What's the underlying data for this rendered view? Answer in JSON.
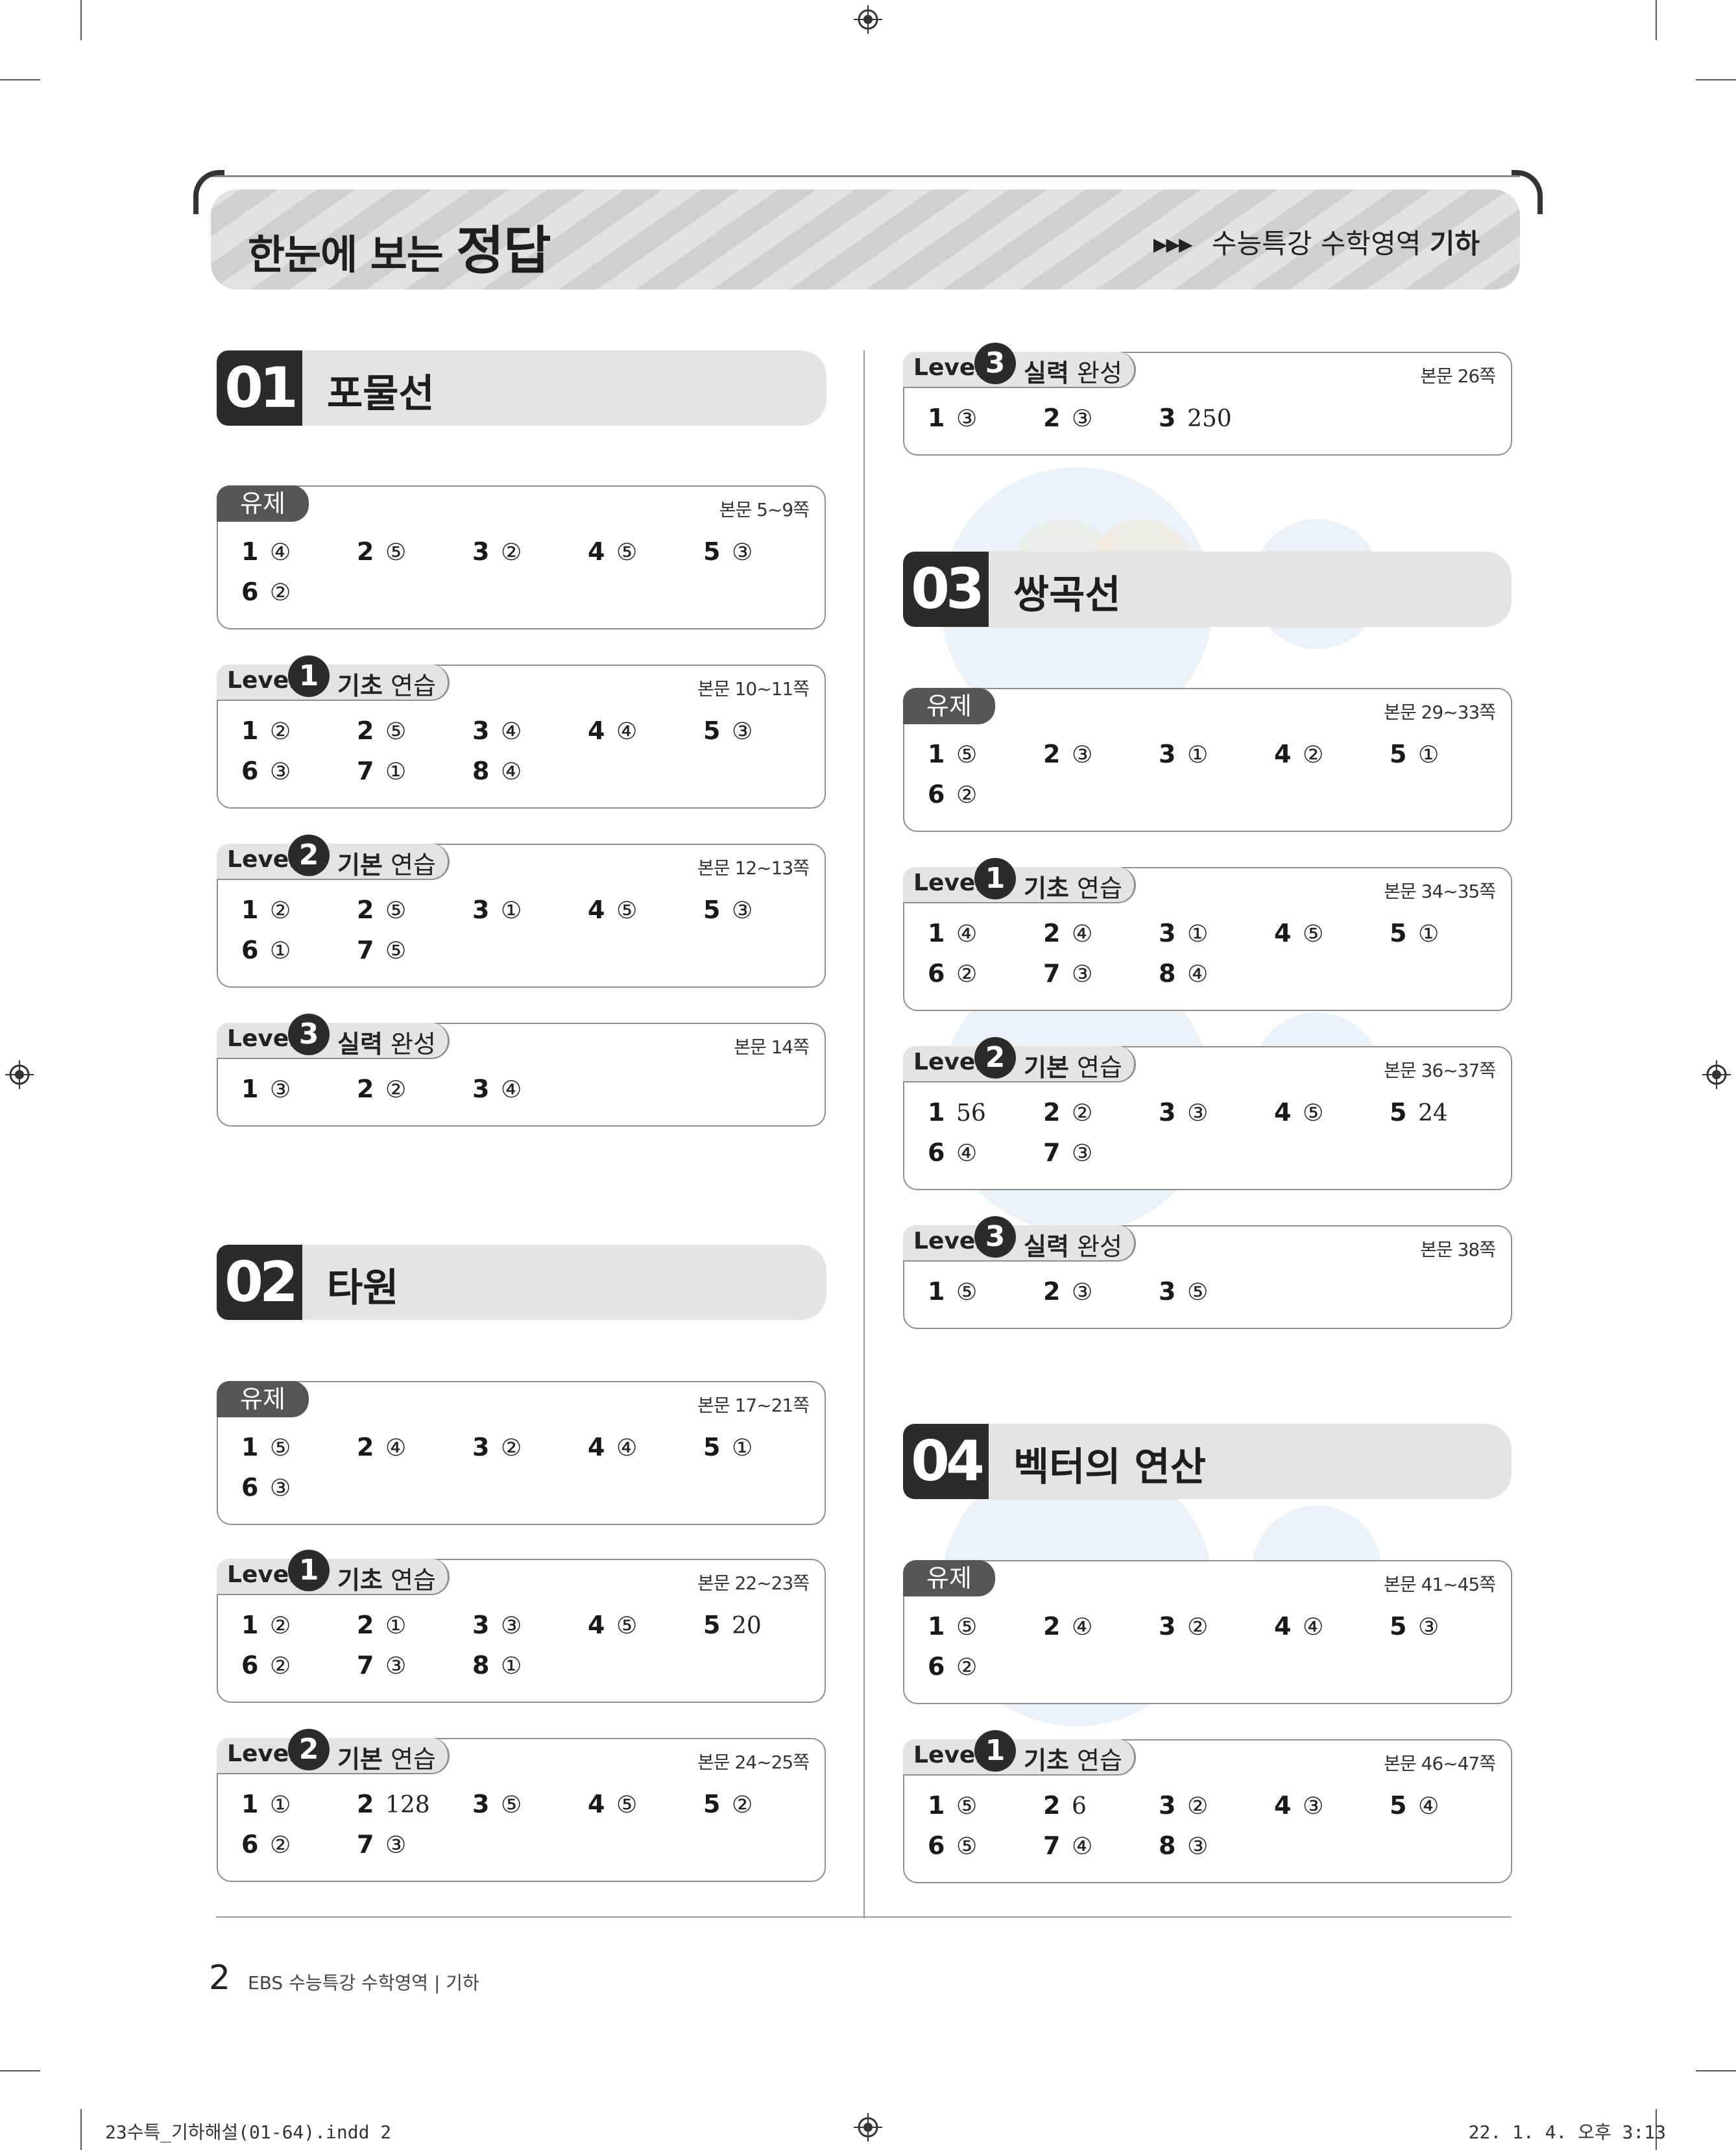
{
  "header": {
    "title_prefix": "한눈에 보는",
    "title_main": "정답",
    "book_prefix": "수능특강 수학영역",
    "book_subject": "기하"
  },
  "chapters": [
    {
      "num": "01",
      "title": "포물선"
    },
    {
      "num": "02",
      "title": "타원"
    },
    {
      "num": "03",
      "title": "쌍곡선"
    },
    {
      "num": "04",
      "title": "벡터의 연산"
    }
  ],
  "boxes": [
    {
      "type": "유제",
      "pages": "본문 5~9쪽",
      "answers": [
        [
          "1",
          "④"
        ],
        [
          "2",
          "⑤"
        ],
        [
          "3",
          "②"
        ],
        [
          "4",
          "⑤"
        ],
        [
          "5",
          "③"
        ],
        [
          "6",
          "②"
        ]
      ]
    },
    {
      "type": "level",
      "level": "1",
      "kind_bold": "기초",
      "kind_rest": "연습",
      "pages": "본문 10~11쪽",
      "answers": [
        [
          "1",
          "②"
        ],
        [
          "2",
          "⑤"
        ],
        [
          "3",
          "④"
        ],
        [
          "4",
          "④"
        ],
        [
          "5",
          "③"
        ],
        [
          "6",
          "③"
        ],
        [
          "7",
          "①"
        ],
        [
          "8",
          "④"
        ]
      ]
    },
    {
      "type": "level",
      "level": "2",
      "kind_bold": "기본",
      "kind_rest": "연습",
      "pages": "본문 12~13쪽",
      "answers": [
        [
          "1",
          "②"
        ],
        [
          "2",
          "⑤"
        ],
        [
          "3",
          "①"
        ],
        [
          "4",
          "⑤"
        ],
        [
          "5",
          "③"
        ],
        [
          "6",
          "①"
        ],
        [
          "7",
          "⑤"
        ]
      ]
    },
    {
      "type": "level",
      "level": "3",
      "kind_bold": "실력",
      "kind_rest": "완성",
      "pages": "본문 14쪽",
      "answers": [
        [
          "1",
          "③"
        ],
        [
          "2",
          "②"
        ],
        [
          "3",
          "④"
        ]
      ]
    },
    {
      "type": "유제",
      "pages": "본문 17~21쪽",
      "answers": [
        [
          "1",
          "⑤"
        ],
        [
          "2",
          "④"
        ],
        [
          "3",
          "②"
        ],
        [
          "4",
          "④"
        ],
        [
          "5",
          "①"
        ],
        [
          "6",
          "③"
        ]
      ]
    },
    {
      "type": "level",
      "level": "1",
      "kind_bold": "기초",
      "kind_rest": "연습",
      "pages": "본문 22~23쪽",
      "answers": [
        [
          "1",
          "②"
        ],
        [
          "2",
          "①"
        ],
        [
          "3",
          "③"
        ],
        [
          "4",
          "⑤"
        ],
        [
          "5",
          "20"
        ],
        [
          "6",
          "②"
        ],
        [
          "7",
          "③"
        ],
        [
          "8",
          "①"
        ]
      ]
    },
    {
      "type": "level",
      "level": "2",
      "kind_bold": "기본",
      "kind_rest": "연습",
      "pages": "본문 24~25쪽",
      "answers": [
        [
          "1",
          "①"
        ],
        [
          "2",
          "128"
        ],
        [
          "3",
          "⑤"
        ],
        [
          "4",
          "⑤"
        ],
        [
          "5",
          "②"
        ],
        [
          "6",
          "②"
        ],
        [
          "7",
          "③"
        ]
      ]
    },
    {
      "type": "level",
      "level": "3",
      "kind_bold": "실력",
      "kind_rest": "완성",
      "pages": "본문 26쪽",
      "answers": [
        [
          "1",
          "③"
        ],
        [
          "2",
          "③"
        ],
        [
          "3",
          "250"
        ]
      ]
    },
    {
      "type": "유제",
      "pages": "본문 29~33쪽",
      "answers": [
        [
          "1",
          "⑤"
        ],
        [
          "2",
          "③"
        ],
        [
          "3",
          "①"
        ],
        [
          "4",
          "②"
        ],
        [
          "5",
          "①"
        ],
        [
          "6",
          "②"
        ]
      ]
    },
    {
      "type": "level",
      "level": "1",
      "kind_bold": "기초",
      "kind_rest": "연습",
      "pages": "본문 34~35쪽",
      "answers": [
        [
          "1",
          "④"
        ],
        [
          "2",
          "④"
        ],
        [
          "3",
          "①"
        ],
        [
          "4",
          "⑤"
        ],
        [
          "5",
          "①"
        ],
        [
          "6",
          "②"
        ],
        [
          "7",
          "③"
        ],
        [
          "8",
          "④"
        ]
      ]
    },
    {
      "type": "level",
      "level": "2",
      "kind_bold": "기본",
      "kind_rest": "연습",
      "pages": "본문 36~37쪽",
      "answers": [
        [
          "1",
          "56"
        ],
        [
          "2",
          "②"
        ],
        [
          "3",
          "③"
        ],
        [
          "4",
          "⑤"
        ],
        [
          "5",
          "24"
        ],
        [
          "6",
          "④"
        ],
        [
          "7",
          "③"
        ]
      ]
    },
    {
      "type": "level",
      "level": "3",
      "kind_bold": "실력",
      "kind_rest": "완성",
      "pages": "본문 38쪽",
      "answers": [
        [
          "1",
          "⑤"
        ],
        [
          "2",
          "③"
        ],
        [
          "3",
          "⑤"
        ]
      ]
    },
    {
      "type": "유제",
      "pages": "본문 41~45쪽",
      "answers": [
        [
          "1",
          "⑤"
        ],
        [
          "2",
          "④"
        ],
        [
          "3",
          "②"
        ],
        [
          "4",
          "④"
        ],
        [
          "5",
          "③"
        ],
        [
          "6",
          "②"
        ]
      ]
    },
    {
      "type": "level",
      "level": "1",
      "kind_bold": "기초",
      "kind_rest": "연습",
      "pages": "본문 46~47쪽",
      "answers": [
        [
          "1",
          "⑤"
        ],
        [
          "2",
          "6"
        ],
        [
          "3",
          "②"
        ],
        [
          "4",
          "③"
        ],
        [
          "5",
          "④"
        ],
        [
          "6",
          "⑤"
        ],
        [
          "7",
          "④"
        ],
        [
          "8",
          "③"
        ]
      ]
    }
  ],
  "level_word": "Level",
  "footer": {
    "page_number": "2",
    "text": "EBS 수능특강 수학영역 | 기하",
    "slug_left": "23수특_기하해설(01-64).indd   2",
    "slug_right": "22. 1. 4.   오후 3:13"
  }
}
